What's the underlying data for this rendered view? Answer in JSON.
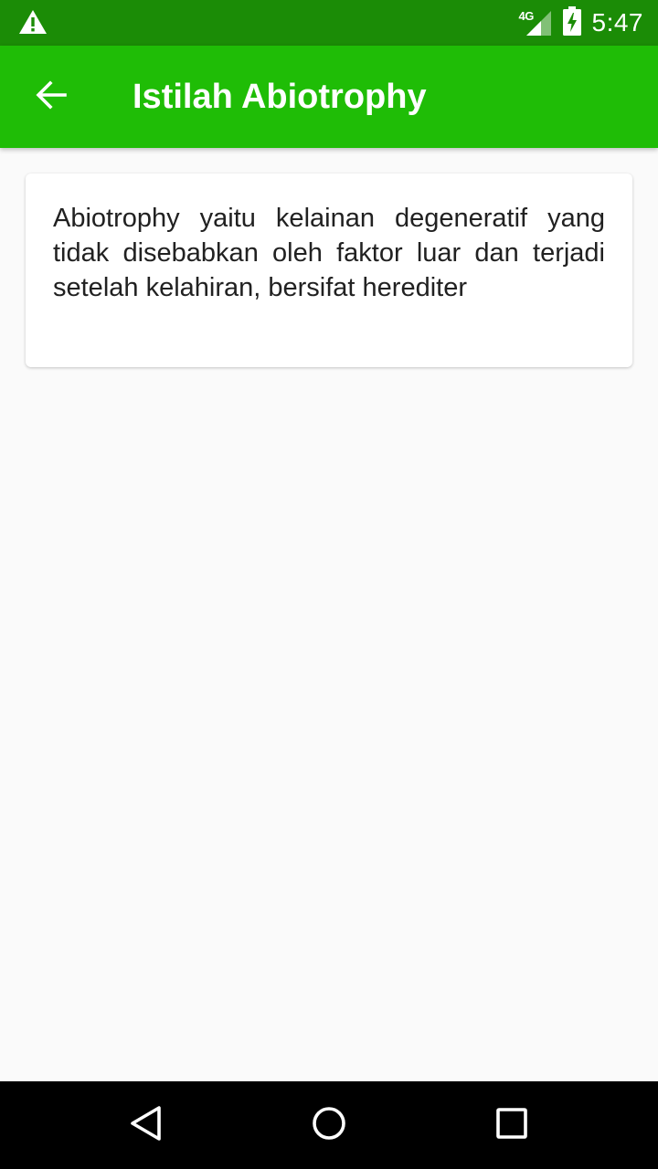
{
  "status_bar": {
    "network_label": "4G",
    "time": "5:47",
    "icons": [
      "warning-icon",
      "signal-icon",
      "battery-charging-icon"
    ]
  },
  "app_bar": {
    "title": "Istilah Abiotrophy",
    "back_icon": "arrow-back-icon",
    "color": "#1fbd06"
  },
  "card": {
    "text": "Abiotrophy yaitu kelainan degeneratif yang tidak disebabkan oleh faktor luar dan terjadi setelah kelahiran, bersifat herediter"
  },
  "nav_bar": {
    "icons": [
      "back-triangle-icon",
      "home-circle-icon",
      "recents-square-icon"
    ]
  }
}
